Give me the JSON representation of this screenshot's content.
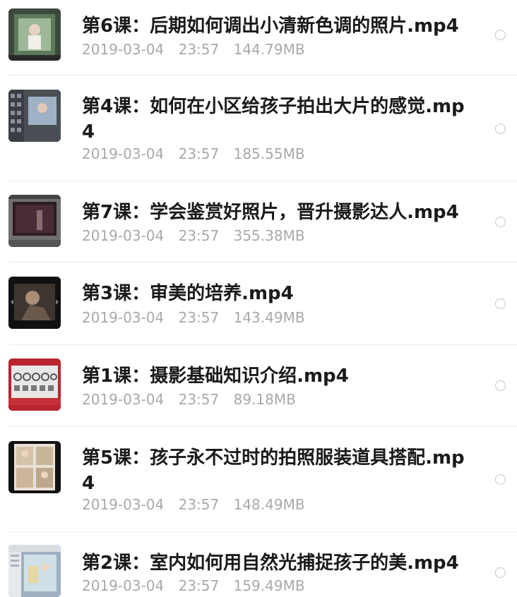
{
  "files": [
    {
      "title": "第6课：后期如何调出小清新色调的照片.mp4",
      "date": "2019-03-04",
      "time": "23:57",
      "size": "144.79MB",
      "thumb_icon": "photo-editing-thumbnail"
    },
    {
      "title": "第4课：如何在小区给孩子拍出大片的感觉.mp4",
      "date": "2019-03-04",
      "time": "23:57",
      "size": "185.55MB",
      "thumb_icon": "software-grid-thumbnail"
    },
    {
      "title": "第7课：学会鉴赏好照片，晋升摄影达人.mp4",
      "date": "2019-03-04",
      "time": "23:57",
      "size": "355.38MB",
      "thumb_icon": "dark-photo-thumbnail"
    },
    {
      "title": "第3课：审美的培养.mp4",
      "date": "2019-03-04",
      "time": "23:57",
      "size": "143.49MB",
      "thumb_icon": "dark-portrait-thumbnail"
    },
    {
      "title": "第1课：摄影基础知识介绍.mp4",
      "date": "2019-03-04",
      "time": "23:57",
      "size": "89.18MB",
      "thumb_icon": "camera-dials-thumbnail"
    },
    {
      "title": "第5课：孩子永不过时的拍照服装道具搭配.mp4",
      "date": "2019-03-04",
      "time": "23:57",
      "size": "148.49MB",
      "thumb_icon": "photo-collage-thumbnail"
    },
    {
      "title": "第2课：室内如何用自然光捕捉孩子的美.mp4",
      "date": "2019-03-04",
      "time": "23:57",
      "size": "159.49MB",
      "thumb_icon": "window-light-thumbnail"
    }
  ],
  "colors": {
    "title": "#1a1a1a",
    "meta": "#a9a9a9",
    "divider": "#ececec",
    "radio": "#c4c4c4"
  }
}
